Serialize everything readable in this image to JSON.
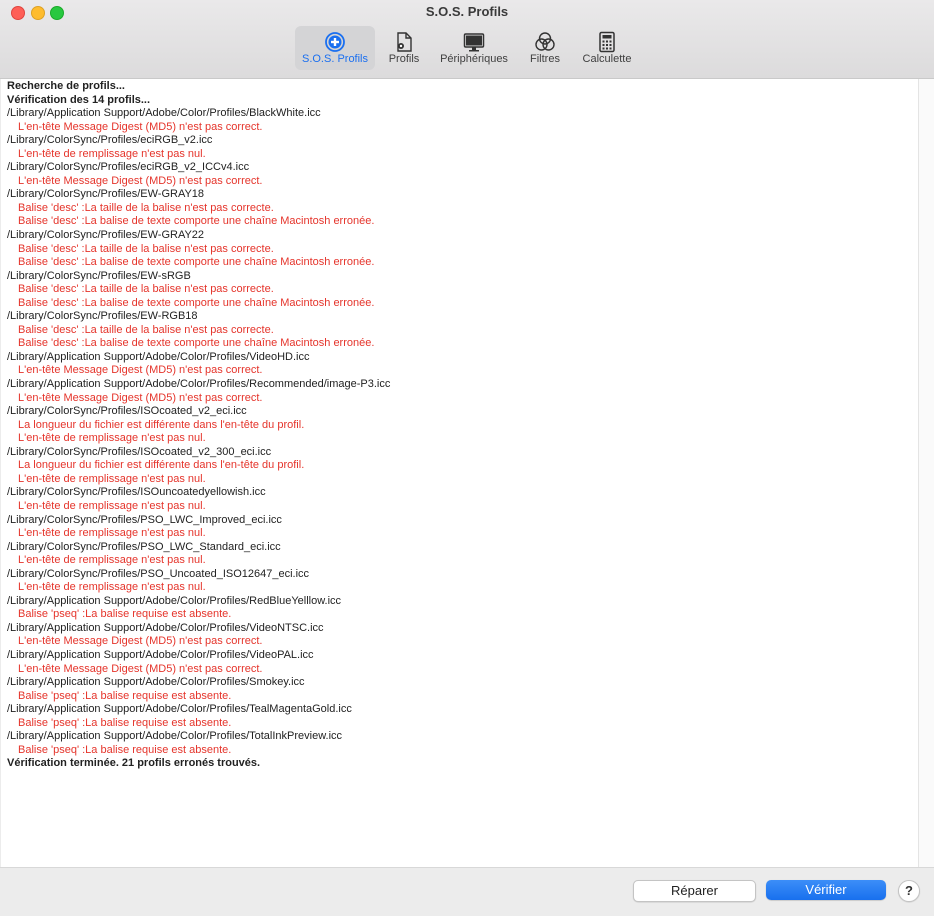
{
  "window": {
    "title": "S.O.S. Profils"
  },
  "toolbar": {
    "items": [
      {
        "label": "S.O.S. Profils",
        "icon": "plus-circle-icon",
        "selected": true
      },
      {
        "label": "Profils",
        "icon": "profile-document-icon",
        "selected": false
      },
      {
        "label": "Périphériques",
        "icon": "monitor-icon",
        "selected": false
      },
      {
        "label": "Filtres",
        "icon": "color-filter-icon",
        "selected": false
      },
      {
        "label": "Calculette",
        "icon": "calculator-icon",
        "selected": false
      }
    ]
  },
  "colors": {
    "accent": "#1a6ff0",
    "error": "#e5342b",
    "text": "#222222"
  },
  "log": [
    {
      "type": "bold",
      "text": "Recherche de profils..."
    },
    {
      "type": "bold",
      "text": "Vérification des 14 profils..."
    },
    {
      "type": "path",
      "text": "/Library/Application Support/Adobe/Color/Profiles/BlackWhite.icc"
    },
    {
      "type": "err",
      "text": "L'en-tête Message Digest (MD5) n'est pas correct."
    },
    {
      "type": "path",
      "text": "/Library/ColorSync/Profiles/eciRGB_v2.icc"
    },
    {
      "type": "err",
      "text": "L'en-tête de remplissage n'est pas nul."
    },
    {
      "type": "path",
      "text": "/Library/ColorSync/Profiles/eciRGB_v2_ICCv4.icc"
    },
    {
      "type": "err",
      "text": "L'en-tête Message Digest (MD5) n'est pas correct."
    },
    {
      "type": "path",
      "text": "/Library/ColorSync/Profiles/EW-GRAY18"
    },
    {
      "type": "err",
      "text": "Balise 'desc' :La taille de la balise n'est pas correcte."
    },
    {
      "type": "err",
      "text": "Balise 'desc' :La balise de texte comporte une chaîne Macintosh erronée."
    },
    {
      "type": "path",
      "text": "/Library/ColorSync/Profiles/EW-GRAY22"
    },
    {
      "type": "err",
      "text": "Balise 'desc' :La taille de la balise n'est pas correcte."
    },
    {
      "type": "err",
      "text": "Balise 'desc' :La balise de texte comporte une chaîne Macintosh erronée."
    },
    {
      "type": "path",
      "text": "/Library/ColorSync/Profiles/EW-sRGB"
    },
    {
      "type": "err",
      "text": "Balise 'desc' :La taille de la balise n'est pas correcte."
    },
    {
      "type": "err",
      "text": "Balise 'desc' :La balise de texte comporte une chaîne Macintosh erronée."
    },
    {
      "type": "path",
      "text": "/Library/ColorSync/Profiles/EW-RGB18"
    },
    {
      "type": "err",
      "text": "Balise 'desc' :La taille de la balise n'est pas correcte."
    },
    {
      "type": "err",
      "text": "Balise 'desc' :La balise de texte comporte une chaîne Macintosh erronée."
    },
    {
      "type": "path",
      "text": "/Library/Application Support/Adobe/Color/Profiles/VideoHD.icc"
    },
    {
      "type": "err",
      "text": "L'en-tête Message Digest (MD5) n'est pas correct."
    },
    {
      "type": "path",
      "text": "/Library/Application Support/Adobe/Color/Profiles/Recommended/image-P3.icc"
    },
    {
      "type": "err",
      "text": "L'en-tête Message Digest (MD5) n'est pas correct."
    },
    {
      "type": "path",
      "text": "/Library/ColorSync/Profiles/ISOcoated_v2_eci.icc"
    },
    {
      "type": "err",
      "text": "La longueur du fichier est différente dans l'en-tête du profil."
    },
    {
      "type": "err",
      "text": "L'en-tête de remplissage n'est pas nul."
    },
    {
      "type": "path",
      "text": "/Library/ColorSync/Profiles/ISOcoated_v2_300_eci.icc"
    },
    {
      "type": "err",
      "text": "La longueur du fichier est différente dans l'en-tête du profil."
    },
    {
      "type": "err",
      "text": "L'en-tête de remplissage n'est pas nul."
    },
    {
      "type": "path",
      "text": "/Library/ColorSync/Profiles/ISOuncoatedyellowish.icc"
    },
    {
      "type": "err",
      "text": "L'en-tête de remplissage n'est pas nul."
    },
    {
      "type": "path",
      "text": "/Library/ColorSync/Profiles/PSO_LWC_Improved_eci.icc"
    },
    {
      "type": "err",
      "text": "L'en-tête de remplissage n'est pas nul."
    },
    {
      "type": "path",
      "text": "/Library/ColorSync/Profiles/PSO_LWC_Standard_eci.icc"
    },
    {
      "type": "err",
      "text": "L'en-tête de remplissage n'est pas nul."
    },
    {
      "type": "path",
      "text": "/Library/ColorSync/Profiles/PSO_Uncoated_ISO12647_eci.icc"
    },
    {
      "type": "err",
      "text": "L'en-tête de remplissage n'est pas nul."
    },
    {
      "type": "path",
      "text": "/Library/Application Support/Adobe/Color/Profiles/RedBlueYelllow.icc"
    },
    {
      "type": "err",
      "text": "Balise 'pseq' :La balise requise est absente."
    },
    {
      "type": "path",
      "text": "/Library/Application Support/Adobe/Color/Profiles/VideoNTSC.icc"
    },
    {
      "type": "err",
      "text": "L'en-tête Message Digest (MD5) n'est pas correct."
    },
    {
      "type": "path",
      "text": "/Library/Application Support/Adobe/Color/Profiles/VideoPAL.icc"
    },
    {
      "type": "err",
      "text": "L'en-tête Message Digest (MD5) n'est pas correct."
    },
    {
      "type": "path",
      "text": "/Library/Application Support/Adobe/Color/Profiles/Smokey.icc"
    },
    {
      "type": "err",
      "text": "Balise 'pseq' :La balise requise est absente."
    },
    {
      "type": "path",
      "text": "/Library/Application Support/Adobe/Color/Profiles/TealMagentaGold.icc"
    },
    {
      "type": "err",
      "text": "Balise 'pseq' :La balise requise est absente."
    },
    {
      "type": "path",
      "text": "/Library/Application Support/Adobe/Color/Profiles/TotalInkPreview.icc"
    },
    {
      "type": "err",
      "text": "Balise 'pseq' :La balise requise est absente."
    },
    {
      "type": "bold",
      "text": "Vérification terminée. 21 profils erronés trouvés."
    }
  ],
  "footer": {
    "repair_label": "Réparer",
    "verify_label": "Vérifier",
    "help_label": "?"
  }
}
